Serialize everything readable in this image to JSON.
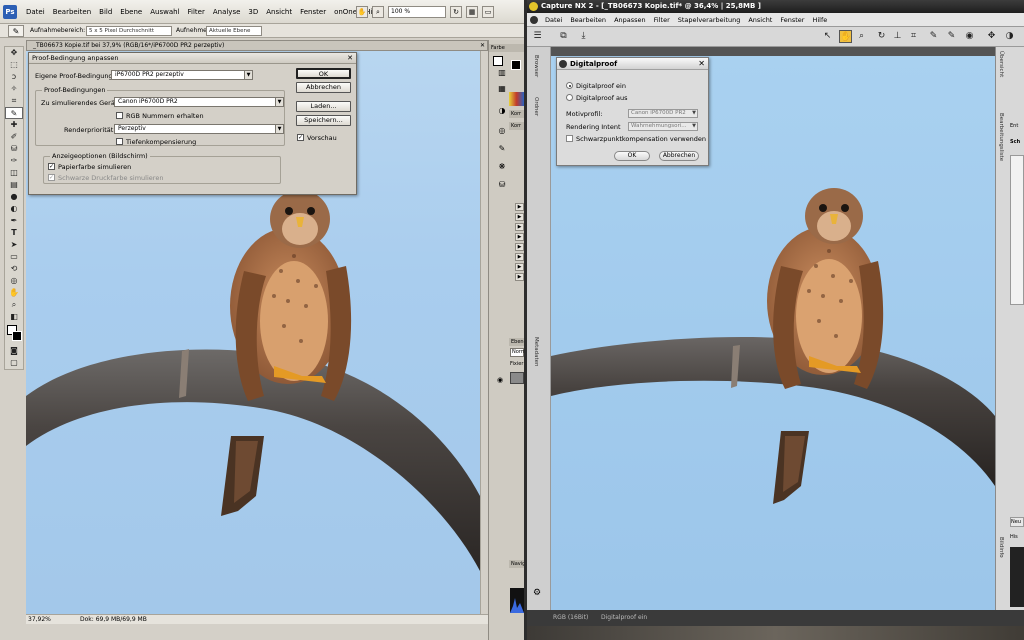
{
  "photoshop": {
    "logo": "Ps",
    "menus": [
      "Datei",
      "Bearbeiten",
      "Bild",
      "Ebene",
      "Auswahl",
      "Filter",
      "Analyse",
      "3D",
      "Ansicht",
      "Fenster",
      "onOne",
      "Hilfe"
    ],
    "zoom_select": "100 %",
    "options_bar": {
      "sample_size_label": "Aufnahmebereich:",
      "sample_size_value": "5 x 5 Pixel Durchschnitt",
      "sample_label": "Aufnehmen:",
      "sample_value": "Aktuelle Ebene"
    },
    "doc_tab": "_TB06673 Kopie.tif bei 37,9% (RGB/16*/iP6700D PR2 perzeptiv)",
    "status": {
      "zoom": "37,92%",
      "doc": "Dok: 69,9 MB/69,9 MB"
    },
    "panel_labels": {
      "farbe": "Farbe",
      "korr1": "Korr",
      "korr2": "Korr",
      "ebene": "Ebene",
      "normal": "Norm",
      "fixier": "Fixier",
      "navi": "Navig"
    }
  },
  "proof_dialog": {
    "title": "Proof-Bedingung anpassen",
    "custom_label": "Eigene Proof-Bedingung:",
    "custom_value": "iP6700D PR2 perzeptiv",
    "group_proof": "Proof-Bedingungen",
    "device_label": "Zu simulierendes Gerät:",
    "device_value": "Canon iP6700D PR2",
    "rgb_preserve": "RGB  Nummern erhalten",
    "intent_label": "Renderpriorität:",
    "intent_value": "Perzeptiv",
    "blackpoint": "Tiefenkompensierung",
    "group_display": "Anzeigeoptionen (Bildschirm)",
    "paper_sim": "Papierfarbe simulieren",
    "ink_sim": "Schwarze Druckfarbe simulieren",
    "btn_ok": "OK",
    "btn_cancel": "Abbrechen",
    "btn_load": "Laden...",
    "btn_save": "Speichern...",
    "preview": "Vorschau"
  },
  "nx": {
    "title": "Capture NX 2 - [_TB06673 Kopie.tif* @ 36,4% | 25,8MB ]",
    "menus": [
      "Datei",
      "Bearbeiten",
      "Anpassen",
      "Filter",
      "Stapelverarbeitung",
      "Ansicht",
      "Fenster",
      "Hilfe"
    ],
    "left_tabs": [
      "Browser",
      "Ordner",
      "Metadaten"
    ],
    "right_tabs": [
      "Übersicht",
      "Bearbeitungsliste",
      "Bildinfo"
    ],
    "bottom": {
      "mode": "RGB (16Bit)",
      "proof": "Digitalproof ein"
    },
    "right_labels": {
      "ent": "Ent",
      "sch": "Sch",
      "neu": "Neu",
      "his": "His"
    }
  },
  "dp_dialog": {
    "title": "Digitalproof",
    "opt_on": "Digitalproof ein",
    "opt_off": "Digitalproof aus",
    "profile_label": "Motivprofil:",
    "profile_value": "Canon iP6700D PR2",
    "intent_label": "Rendering Intent",
    "intent_value": "Wahrnehmungsori...",
    "blackpoint": "Schwarzpunktkompensation verwenden",
    "btn_ok": "OK",
    "btn_cancel": "Abbrechen"
  }
}
